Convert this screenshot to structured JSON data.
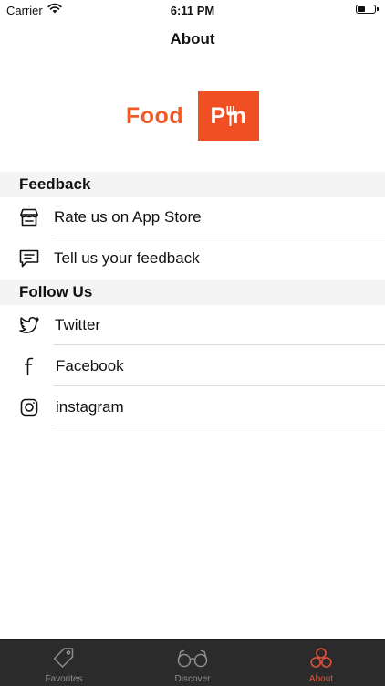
{
  "status_bar": {
    "carrier": "Carrier",
    "time": "6:11 PM"
  },
  "nav": {
    "title": "About"
  },
  "logo": {
    "word": "Food",
    "badge": "P  n"
  },
  "sections": {
    "feedback": {
      "title": "Feedback",
      "items": [
        {
          "label": "Rate us on App Store",
          "icon": "store-icon"
        },
        {
          "label": "Tell us your feedback",
          "icon": "chat-icon"
        }
      ]
    },
    "follow": {
      "title": "Follow Us",
      "items": [
        {
          "label": "Twitter",
          "icon": "twitter-icon"
        },
        {
          "label": "Facebook",
          "icon": "facebook-icon"
        },
        {
          "label": "instagram",
          "icon": "instagram-icon"
        }
      ]
    }
  },
  "tab_bar": {
    "tabs": [
      {
        "label": "Favorites",
        "icon": "tag-icon"
      },
      {
        "label": "Discover",
        "icon": "glasses-icon"
      },
      {
        "label": "About",
        "icon": "circles-icon",
        "active": true
      }
    ],
    "active_color": "#e0533a",
    "inactive_color": "#8d8d8d"
  },
  "colors": {
    "brand": "#f04e23",
    "tab_bar_bg": "#2b2b2b"
  }
}
